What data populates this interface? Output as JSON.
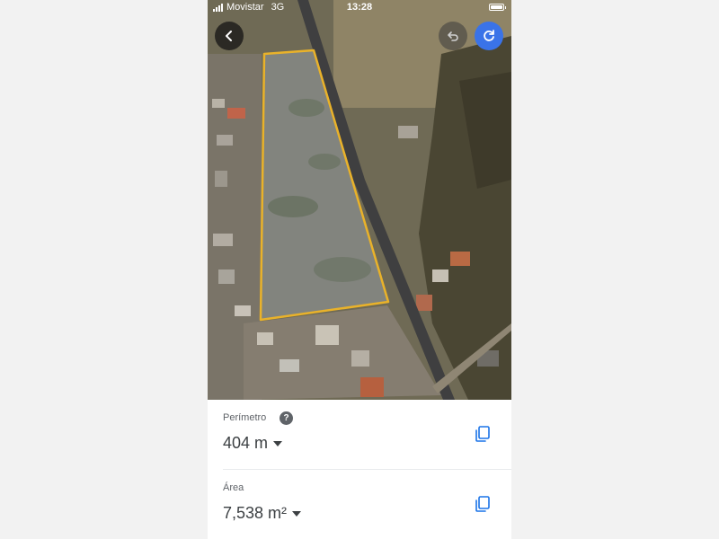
{
  "status_bar": {
    "carrier": "Movistar",
    "network": "3G",
    "time": "13:28"
  },
  "map": {
    "polygon_stroke_color": "#e9b22a",
    "polygon_fill_color": "#9aa5b1"
  },
  "buttons": {
    "back_icon": "chevron-left-icon",
    "undo_icon": "undo-icon",
    "refresh_icon": "refresh-icon",
    "refresh_color": "#3a73e8"
  },
  "measurements": {
    "perimeter": {
      "label": "Perímetro",
      "help": "?",
      "value": "404 m"
    },
    "area": {
      "label": "Área",
      "value": "7,538 m²"
    }
  }
}
